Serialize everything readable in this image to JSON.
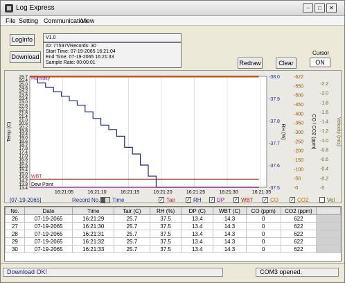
{
  "window": {
    "title": "Log Express",
    "min_glyph": "–",
    "max_glyph": "□",
    "close_glyph": "✕"
  },
  "menu": {
    "file": "File",
    "setting": "Setting",
    "communication": "Communication",
    "view": "View"
  },
  "buttons": {
    "loginfo": "LogInfo",
    "download": "Download",
    "redraw": "Redraw",
    "clear": "Clear",
    "cursor_label": "Cursor",
    "cursor_state": "ON"
  },
  "info": {
    "version": "V1.0",
    "id_line": "ID:               77597VRecords: 30",
    "start_time": "Start Time:  07-19-2065 16:21:04",
    "end_time": "End Time:    07-19-2065 16:21:33",
    "sample_rate": "Sample Rate:           00:00:01"
  },
  "chart": {
    "left_axis_title": "Temp (C)",
    "rh_axis_title": "RH (%)",
    "co_axis_title": "CO / CO2 (ppm)",
    "vel_axis_title": "Velocity (m/s)",
    "temp_ticks": [
      "25.7",
      "25.4",
      "25.0",
      "24.6",
      "24.2",
      "23.8",
      "23.4",
      "23.0",
      "22.6",
      "22.2",
      "21.8",
      "21.4",
      "21.0",
      "20.6",
      "20.2",
      "19.8",
      "19.4",
      "19.0",
      "18.6",
      "18.2",
      "17.8",
      "17.4",
      "17.0",
      "16.6",
      "16.2",
      "15.8",
      "15.4",
      "15.0",
      "14.6",
      "14.2",
      "13.8",
      "13.4"
    ],
    "rh_ticks": [
      "38.0",
      "37.9",
      "37.8",
      "37.7",
      "37.6",
      "37.5"
    ],
    "co_ticks": [
      "622",
      "550",
      "500",
      "450",
      "400",
      "350",
      "300",
      "250",
      "200",
      "150",
      "100",
      "50",
      "0"
    ],
    "vel_ticks": [
      "2.2",
      "2.0",
      "1.8",
      "1.6",
      "1.4",
      "1.2",
      "1.0",
      "0.8",
      "0.6",
      "0.4",
      "0.2",
      "0"
    ],
    "x_ticks": [
      "16:21:05",
      "16:21:10",
      "16:21:15",
      "16:21:20",
      "16:21:25",
      "16:21:30",
      "16:21:35"
    ],
    "label_humidity": "Humidity",
    "label_wbt": "WBT",
    "label_dewpoint": "Dew Point"
  },
  "chart_data": {
    "type": "line",
    "x": [
      "16:21:04",
      "16:21:05",
      "16:21:06",
      "16:21:07",
      "16:21:08",
      "16:21:09",
      "16:21:10",
      "16:21:11",
      "16:21:12",
      "16:21:13",
      "16:21:14",
      "16:21:15",
      "16:21:16",
      "16:21:17",
      "16:21:18",
      "16:21:19",
      "16:21:20",
      "16:21:21",
      "16:21:33"
    ],
    "series": [
      {
        "name": "RH",
        "axis": "RH (%)",
        "values": [
          38.0,
          37.97,
          37.95,
          37.93,
          37.91,
          37.89,
          37.87,
          37.84,
          37.81,
          37.78,
          37.76,
          37.73,
          37.68,
          37.65,
          37.6,
          37.55,
          37.5,
          37.5,
          37.5
        ]
      },
      {
        "name": "Tair",
        "axis": "Temp (C)",
        "values": [
          25.7,
          25.7,
          25.7,
          25.7,
          25.7,
          25.7,
          25.7,
          25.7,
          25.7,
          25.7,
          25.7,
          25.7,
          25.7,
          25.7,
          25.7,
          25.7,
          25.7,
          25.7,
          25.7
        ]
      },
      {
        "name": "WBT",
        "axis": "Temp (C)",
        "values": [
          14.3,
          14.3,
          14.3,
          14.3,
          14.3,
          14.3,
          14.3,
          14.3,
          14.3,
          14.3,
          14.3,
          14.3,
          14.3,
          14.3,
          14.3,
          14.3,
          14.3,
          14.3,
          14.3
        ]
      },
      {
        "name": "DP",
        "axis": "Temp (C)",
        "values": [
          13.4,
          13.4,
          13.4,
          13.4,
          13.4,
          13.4,
          13.4,
          13.4,
          13.4,
          13.4,
          13.4,
          13.4,
          13.4,
          13.4,
          13.4,
          13.4,
          13.4,
          13.4,
          13.4
        ]
      },
      {
        "name": "CO2",
        "axis": "CO / CO2 (ppm)",
        "values": [
          622,
          622,
          622,
          622,
          622,
          622,
          622,
          622,
          622,
          622,
          622,
          622,
          622,
          622,
          622,
          622,
          622,
          622,
          622
        ]
      }
    ],
    "xlabel": "",
    "ylabel": "Temp (C)",
    "ylim": [
      13.4,
      25.7
    ],
    "y2lim": [
      37.5,
      38.0
    ]
  },
  "legend": {
    "date": "[07-19-2065]",
    "record_no": "Record No.",
    "time": "Time",
    "tair": "Tair",
    "rh": "RH",
    "dp": "DP",
    "wbt": "WBT",
    "co": "CO",
    "co2": "CO2",
    "vel": "Vel",
    "colors": {
      "tair": "#b52020",
      "rh": "#1e2a8a",
      "dp": "#8a1f8a",
      "wbt": "#b52020",
      "co": "#c07000",
      "co2": "#c07000",
      "vel": "#6a6a30"
    }
  },
  "table": {
    "headers": [
      "No.",
      "Date",
      "Time",
      "Tair (C)",
      "RH (%)",
      "DP (C)",
      "WBT (C)",
      "CO (ppm)",
      "CO2 (ppm)"
    ],
    "rows": [
      [
        "26",
        "07-19-2065",
        "16:21:29",
        "25.7",
        "37.5",
        "13.4",
        "14.3",
        "0",
        "622"
      ],
      [
        "27",
        "07-19-2065",
        "16:21:30",
        "25.7",
        "37.5",
        "13.4",
        "14.3",
        "0",
        "622"
      ],
      [
        "28",
        "07-19-2065",
        "16:21:31",
        "25.7",
        "37.5",
        "13.4",
        "14.3",
        "0",
        "622"
      ],
      [
        "29",
        "07-19-2065",
        "16:21:32",
        "25.7",
        "37.5",
        "13.4",
        "14.3",
        "0",
        "622"
      ],
      [
        "30",
        "07-19-2065",
        "16:21:33",
        "25.7",
        "37.5",
        "13.4",
        "14.3",
        "0",
        "622"
      ]
    ]
  },
  "status": {
    "left": "Download OK!",
    "right": "COM3 opened."
  }
}
